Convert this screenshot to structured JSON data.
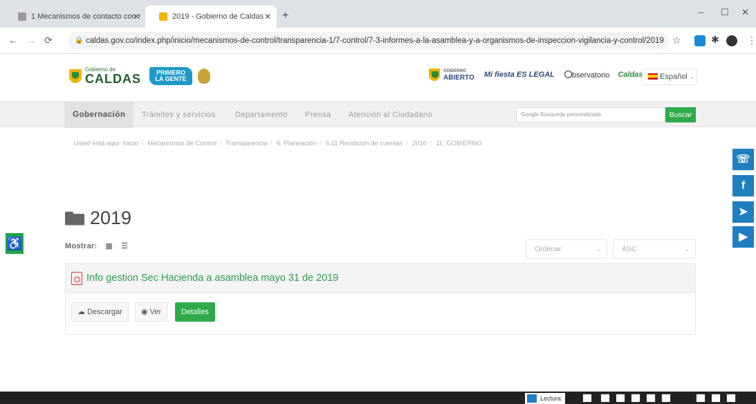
{
  "browser": {
    "tabs": [
      {
        "title": "1 Mecanismos de contacto con r"
      },
      {
        "title": "2019 - Gobierno de Caldas"
      }
    ],
    "new_tab": "+",
    "url": "caldas.gov.co/index.php/inicio/mecanismos-de-control/transparencia-1/7-control/7-3-informes-a-la-asamblea-y-a-organismos-de-inspeccion-vigilancia-y-control/2019",
    "window_controls": {
      "minimize": "–",
      "maximize": "☐",
      "close": "✕"
    }
  },
  "header": {
    "logo_small": "Gobierno de",
    "logo_big": "CALDAS",
    "primero": "PRIMERO LA GENTE",
    "gob_abierto": "ABIERTO",
    "gob_abierto_small": "GOBIERNO",
    "mifiesta": "Mi fiesta ES LEGAL",
    "observatorio": "bservatorio",
    "caldas_brand": "Caldas",
    "lang": "Español"
  },
  "nav": {
    "items": [
      "Gobernación",
      "Trámites y servicios",
      "Departamento",
      "Prensa",
      "Atención al Ciudadano"
    ],
    "search_placeholder": "Google Búsqueda personalizada",
    "search_button": "Buscar"
  },
  "breadcrumb": {
    "prefix": "Usted está aquí:",
    "items": [
      "Inicio",
      "Mecanismos de Control",
      "Transparencia",
      "6. Planeación",
      "6.11 Rendición de cuentas",
      "2016",
      "11. GOBIERNO"
    ]
  },
  "content": {
    "folder_title": "2019",
    "mostrar_label": "Mostrar:",
    "order_select": "Ordenar",
    "dir_select": "ASC",
    "file_name": "Info gestion Sec Hacienda a asamblea mayo 31 de 2019",
    "btn_download": "Descargar",
    "btn_view": "Ver",
    "btn_details": "Detalles"
  },
  "bottom": {
    "lectura": "Lectura"
  },
  "icons": {
    "social": [
      "chat-icon",
      "facebook-icon",
      "twitter-icon",
      "youtube-icon"
    ],
    "accessibility": "accessibility-icon"
  },
  "colors": {
    "green": "#2eaa4a",
    "blue": "#1f7fbf"
  }
}
